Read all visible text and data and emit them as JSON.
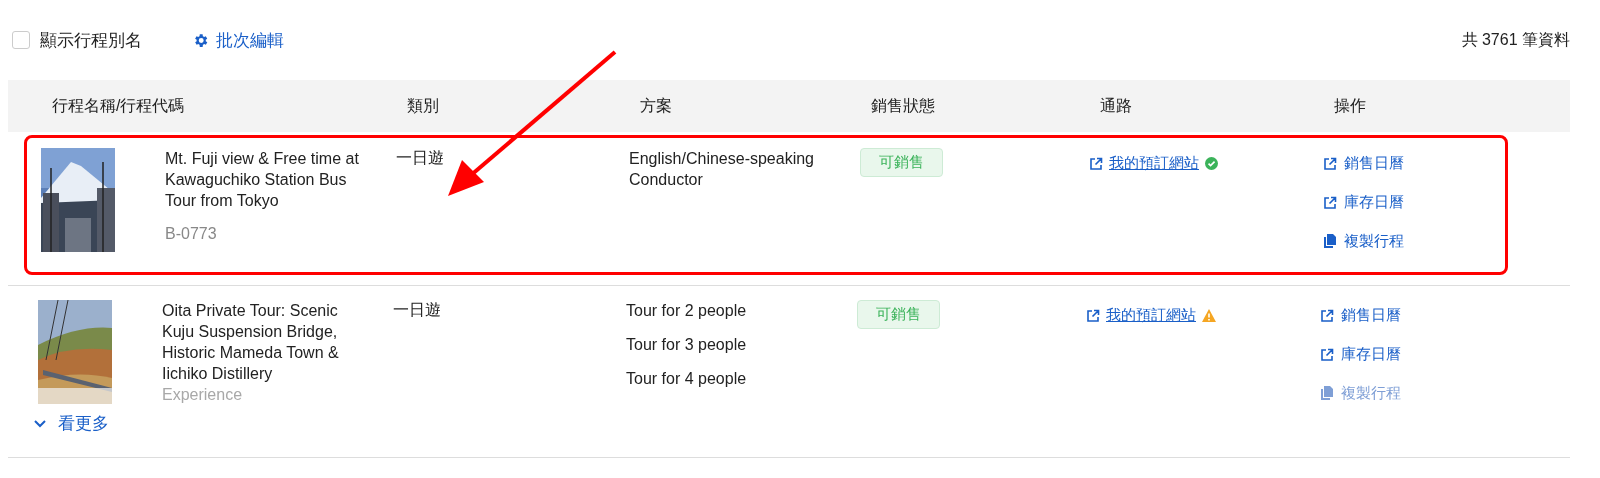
{
  "toolbar": {
    "show_alias": {
      "label": "顯示行程別名",
      "checked": false
    },
    "batch_edit": "批次編輯",
    "total": "共 3761 筆資料"
  },
  "table": {
    "columns": [
      "行程名稱/行程代碼",
      "類別",
      "方案",
      "銷售狀態",
      "通路",
      "操作"
    ],
    "rows": [
      {
        "highlighted": true,
        "faded": false,
        "picture": {
          "kind": "picture"
        },
        "name": "Mt. Fuji view & Free time at Kawaguchiko Station Bus Tour from Tokyo",
        "code": "B-0773",
        "category": "一日遊",
        "plans": [
          "English/Chinese-speaking Conductor"
        ],
        "status": "可銷售",
        "channel": {
          "label": "我的預訂網站",
          "kind": "ok"
        },
        "actions": [
          {
            "kind": "external",
            "label": "銷售日曆"
          },
          {
            "kind": "external",
            "label": "庫存日曆"
          },
          {
            "kind": "copy",
            "label": "複製行程"
          }
        ]
      },
      {
        "highlighted": false,
        "faded": true,
        "picture": {
          "kind": "picture"
        },
        "name": "Oita Private Tour: Scenic Kuju Suspension Bridge, Historic Mameda Town & Iichiko Distillery",
        "code": "Experience",
        "category": "一日遊",
        "plans": [
          "Tour for 2 people",
          "Tour for 3 people",
          "Tour for 4 people"
        ],
        "status": "可銷售",
        "channel": {
          "label": "我的預訂網站",
          "kind": "warning"
        },
        "actions": [
          {
            "kind": "external",
            "label": "銷售日曆"
          },
          {
            "kind": "external",
            "label": "庫存日曆"
          },
          {
            "kind": "copy",
            "label": "複製行程"
          }
        ]
      }
    ]
  },
  "more": "看更多"
}
